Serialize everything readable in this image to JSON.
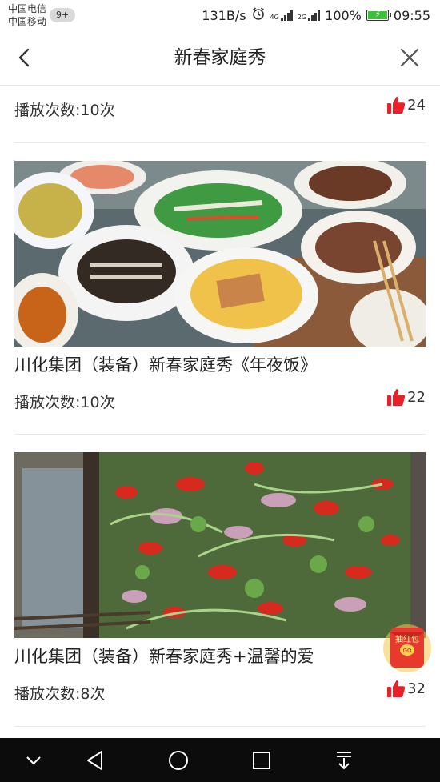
{
  "status_bar": {
    "carrier_1": "中国电信",
    "carrier_2": "中国移动",
    "notification_badge": "9+",
    "net_speed": "131B/s",
    "signal_1_label": "4G",
    "signal_2_label": "2G",
    "battery_percent": "100%",
    "battery_level": 1.0,
    "time": "09:55"
  },
  "header": {
    "title": "新春家庭秀",
    "back_icon": "chevron-left-icon",
    "close_icon": "close-icon"
  },
  "feed": {
    "top_partial": {
      "plays": "播放次数:10次",
      "likes": "24"
    },
    "items": [
      {
        "title": "川化集团（装备）新春家庭秀《年夜饭》",
        "plays": "播放次数:10次",
        "likes": "22",
        "image": "dinner-table-dishes"
      },
      {
        "title": "川化集团（装备）新春家庭秀+温馨的爱",
        "plays": "播放次数:8次",
        "likes": "32",
        "image": "chili-cilantro-salad"
      }
    ]
  },
  "floating": {
    "red_packet_label": "抽红包",
    "red_packet_badge": "GO"
  },
  "colors": {
    "accent_red": "#e6212a",
    "text": "#222222",
    "nav_bar_bg": "#0c0c0c",
    "battery_green": "#3cc13b"
  },
  "system_nav": {
    "icons": [
      "chevron-down-icon",
      "back-triangle-icon",
      "home-circle-icon",
      "recents-square-icon",
      "pull-down-icon"
    ]
  }
}
